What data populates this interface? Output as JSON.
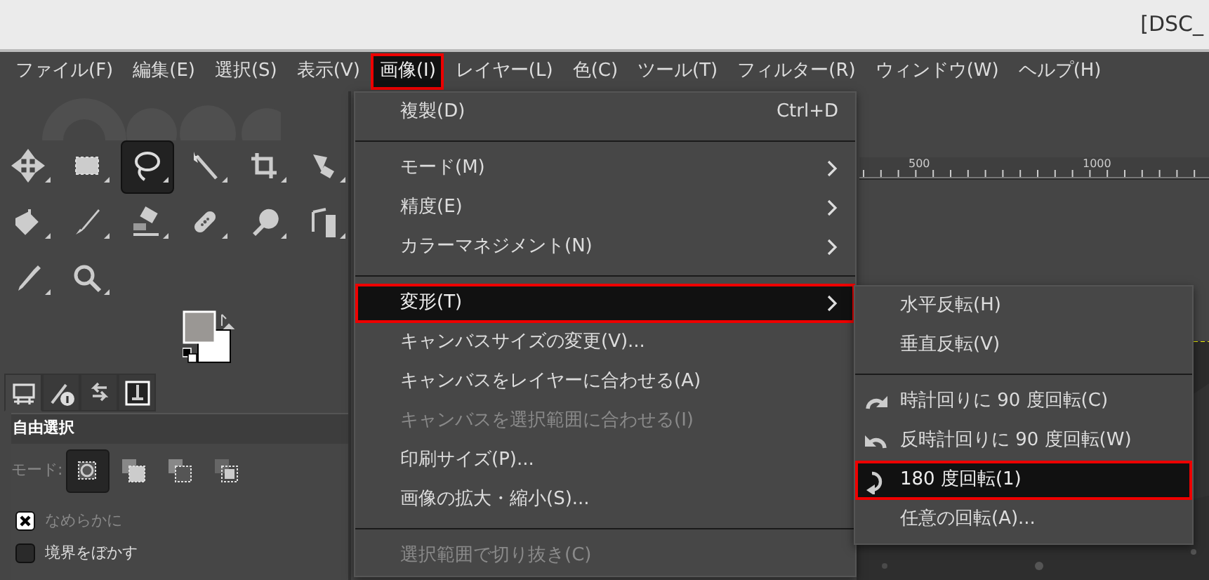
{
  "window": {
    "title": "[DSC_"
  },
  "menubar": [
    {
      "label": "ファイル(F)",
      "selected": false
    },
    {
      "label": "編集(E)",
      "selected": false
    },
    {
      "label": "選択(S)",
      "selected": false
    },
    {
      "label": "表示(V)",
      "selected": false
    },
    {
      "label": "画像(I)",
      "selected": true
    },
    {
      "label": "レイヤー(L)",
      "selected": false
    },
    {
      "label": "色(C)",
      "selected": false
    },
    {
      "label": "ツール(T)",
      "selected": false
    },
    {
      "label": "フィルター(R)",
      "selected": false
    },
    {
      "label": "ウィンドウ(W)",
      "selected": false
    },
    {
      "label": "ヘルプ(H)",
      "selected": false
    }
  ],
  "toolbox": {
    "tools": [
      {
        "selected": false
      },
      {
        "selected": false
      },
      {
        "selected": true
      },
      {
        "selected": false
      },
      {
        "selected": false
      },
      {
        "selected": false
      },
      {
        "selected": false
      },
      {
        "selected": false
      },
      {
        "selected": false
      },
      {
        "selected": false
      },
      {
        "selected": false
      },
      {
        "selected": false
      },
      {
        "selected": false
      },
      {
        "selected": false
      }
    ],
    "tabs": [
      {
        "selected": true
      },
      {
        "selected": false
      },
      {
        "selected": false
      },
      {
        "selected": false
      }
    ],
    "tool_options": {
      "title": "自由選択",
      "mode_label": "モード:",
      "modes": [
        {
          "selected": true
        },
        {
          "selected": false
        },
        {
          "selected": false
        },
        {
          "selected": false
        }
      ],
      "options": [
        {
          "label": "なめらかに",
          "checked": true,
          "disabled": true
        },
        {
          "label": "境界をぼかす",
          "checked": false,
          "disabled": false
        }
      ]
    }
  },
  "ruler": {
    "labels": [
      "500",
      "1000"
    ]
  },
  "image_menu": [
    {
      "kind": "item",
      "label": "複製(D)",
      "shortcut": "Ctrl+D",
      "submenu": false,
      "disabled": false,
      "selected": false
    },
    {
      "kind": "separator"
    },
    {
      "kind": "item",
      "label": "モード(M)",
      "submenu": true,
      "disabled": false,
      "selected": false
    },
    {
      "kind": "item",
      "label": "精度(E)",
      "submenu": true,
      "disabled": false,
      "selected": false
    },
    {
      "kind": "item",
      "label": "カラーマネジメント(N)",
      "submenu": true,
      "disabled": false,
      "selected": false
    },
    {
      "kind": "separator"
    },
    {
      "kind": "item",
      "label": "変形(T)",
      "submenu": true,
      "disabled": false,
      "selected": true
    },
    {
      "kind": "item",
      "label": "キャンバスサイズの変更(V)...",
      "submenu": false,
      "disabled": false,
      "selected": false
    },
    {
      "kind": "item",
      "label": "キャンバスをレイヤーに合わせる(A)",
      "submenu": false,
      "disabled": false,
      "selected": false
    },
    {
      "kind": "item",
      "label": "キャンバスを選択範囲に合わせる(I)",
      "submenu": false,
      "disabled": true,
      "selected": false
    },
    {
      "kind": "item",
      "label": "印刷サイズ(P)...",
      "submenu": false,
      "disabled": false,
      "selected": false
    },
    {
      "kind": "item",
      "label": "画像の拡大・縮小(S)...",
      "submenu": false,
      "disabled": false,
      "selected": false
    },
    {
      "kind": "separator"
    },
    {
      "kind": "item",
      "label": "選択範囲で切り抜き(C)",
      "submenu": false,
      "disabled": true,
      "selected": false
    }
  ],
  "transform_menu": [
    {
      "kind": "item",
      "label": "水平反転(H)",
      "selected": false
    },
    {
      "kind": "item",
      "label": "垂直反転(V)",
      "selected": false
    },
    {
      "kind": "separator"
    },
    {
      "kind": "item",
      "label": "時計回りに 90 度回転(C)",
      "selected": false
    },
    {
      "kind": "item",
      "label": "反時計回りに 90 度回転(W)",
      "selected": false
    },
    {
      "kind": "item",
      "label": "180 度回転(1)",
      "selected": true
    },
    {
      "kind": "item",
      "label": "任意の回転(A)...",
      "selected": false
    }
  ]
}
